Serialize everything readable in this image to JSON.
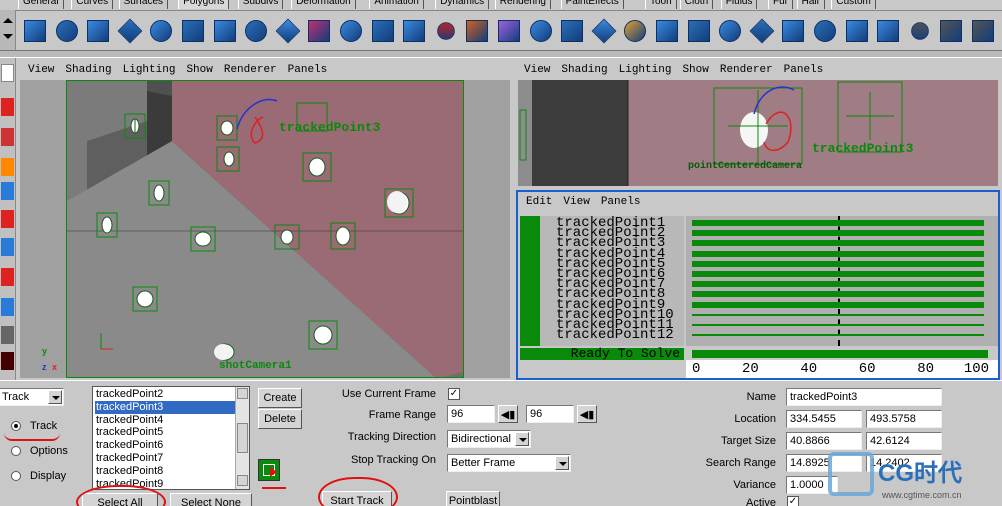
{
  "shelf": {
    "tabs": [
      "General",
      "Curves",
      "Surfaces",
      "Polygons",
      "Subdivs",
      "Deformation",
      "Animation",
      "Dynamics",
      "Rendering",
      "PaintEffects",
      "Toon",
      "Cloth",
      "Fluids",
      "Fur",
      "Hair",
      "Custom"
    ],
    "active_tab": "Polygons"
  },
  "viewport_menu": {
    "items": [
      "View",
      "Shading",
      "Lighting",
      "Show",
      "Renderer",
      "Panels"
    ]
  },
  "viewport_main": {
    "highlighted_track_label": "trackedPoint3",
    "camera_label": "shotCamera1",
    "axis_y": "y",
    "axis_z": "z",
    "axis_x": "x"
  },
  "viewport_secondary": {
    "camera_label": "pointCenteredCamera",
    "track_label": "trackedPoint3"
  },
  "graph_editor": {
    "menu": [
      "Edit",
      "View",
      "Panels"
    ],
    "tracks": [
      "trackedPoint1",
      "trackedPoint2",
      "trackedPoint3",
      "trackedPoint4",
      "trackedPoint5",
      "trackedPoint6",
      "trackedPoint7",
      "trackedPoint8",
      "trackedPoint9",
      "trackedPoint10",
      "trackedPoint11",
      "trackedPoint12"
    ],
    "status": "Ready To Solve",
    "axis_ticks": [
      "0",
      "20",
      "40",
      "60",
      "80",
      "100"
    ],
    "current_frame_marker": 50
  },
  "panel": {
    "mode_dropdown": "Track",
    "radio_options": [
      "Track",
      "Options",
      "Display"
    ],
    "radio_selected": "Track",
    "track_list": [
      "trackedPoint2",
      "trackedPoint3",
      "trackedPoint4",
      "trackedPoint5",
      "trackedPoint6",
      "trackedPoint7",
      "trackedPoint8",
      "trackedPoint9"
    ],
    "track_list_selected": "trackedPoint3",
    "create_button": "Create",
    "delete_button": "Delete",
    "select_all_button": "Select All",
    "select_none_button": "Select None",
    "use_current_frame_label": "Use Current Frame",
    "use_current_frame_checked": true,
    "frame_range_label": "Frame Range",
    "frame_range_start": "96",
    "frame_range_end": "96",
    "tracking_direction_label": "Tracking Direction",
    "tracking_direction_value": "Bidirectional",
    "stop_tracking_label": "Stop Tracking On",
    "stop_tracking_value": "Better Frame",
    "start_track_button": "Start Track",
    "pointblast_button": "Pointblast",
    "name_label": "Name",
    "name_value": "trackedPoint3",
    "location_label": "Location",
    "location_x": "334.5455",
    "location_y": "493.5758",
    "target_size_label": "Target Size",
    "target_size_x": "40.8866",
    "target_size_y": "42.6124",
    "search_range_label": "Search Range",
    "search_range_x": "14.8925",
    "search_range_y": "14.2402",
    "variance_label": "Variance",
    "variance_value": "1.0000",
    "active_label": "Active",
    "active_checked": true
  },
  "watermark": {
    "brand": "CG时代",
    "url": "www.cgtime.com.cn"
  },
  "colors": {
    "track_green": "#0a8a0a",
    "selection_blue": "#316ac5",
    "annotation_red": "#e01010",
    "panel_gray": "#c8c8c8"
  }
}
